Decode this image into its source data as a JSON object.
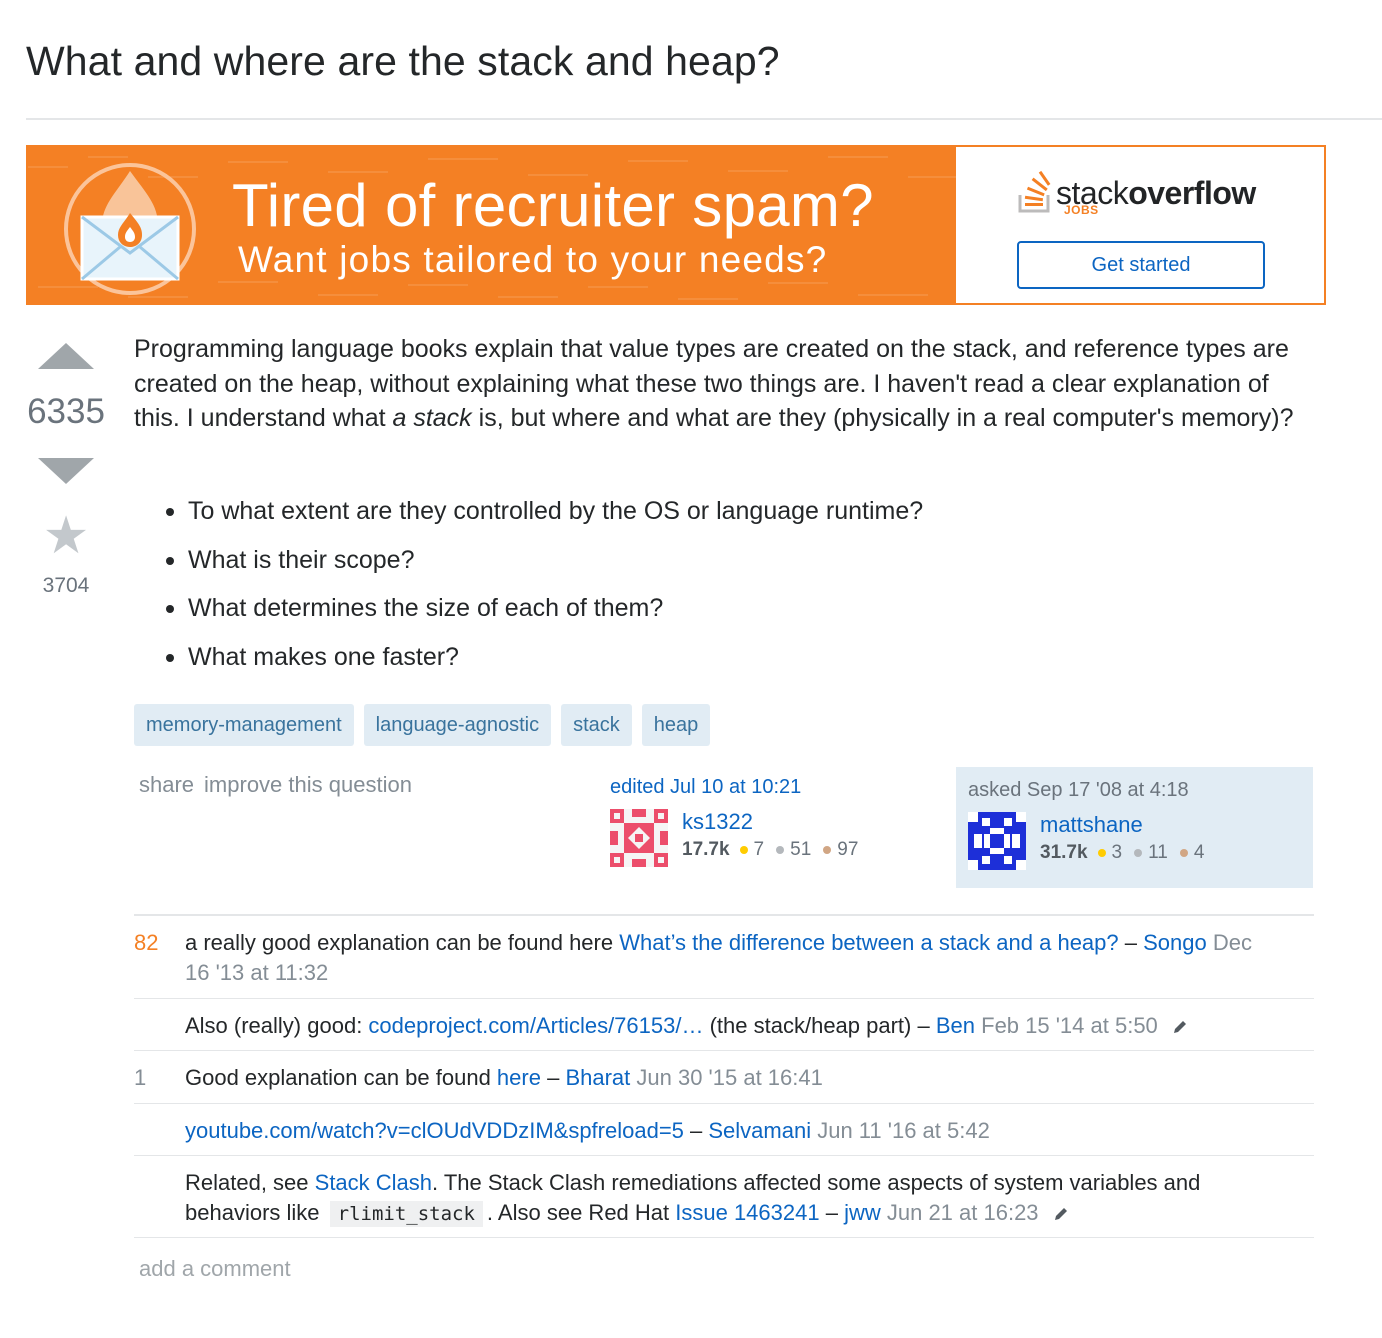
{
  "question": {
    "title": "What and where are the stack and heap?",
    "votes": "6335",
    "favorites": "3704",
    "body_part1": "Programming language books explain that value types are created on the stack, and reference types are created on the heap, without explaining what these two things are. I haven't read a clear explanation of this. I understand what ",
    "body_em": "a stack",
    "body_part2": " is, but where and what are they (physically in a real computer's memory)?",
    "bullets": [
      "To what extent are they controlled by the OS or language runtime?",
      "What is their scope?",
      "What determines the size of each of them?",
      "What makes one faster?"
    ],
    "tags": [
      "memory-management",
      "language-agnostic",
      "stack",
      "heap"
    ]
  },
  "banner": {
    "headline": "Tired of recruiter spam?",
    "subline": "Want jobs tailored to your needs?",
    "logo_light": "stack",
    "logo_bold": "overflow",
    "logo_jobs": "JOBS",
    "button": "Get started"
  },
  "menu": {
    "share": "share",
    "improve": "improve this question"
  },
  "edited": {
    "label": "edited Jul 10 at 10:21",
    "user": "ks1322",
    "rep": "17.7k",
    "gold": "7",
    "silver": "51",
    "bronze": "97"
  },
  "asked": {
    "label": "asked Sep 17 '08 at 4:18",
    "user": "mattshane",
    "rep": "31.7k",
    "gold": "3",
    "silver": "11",
    "bronze": "4"
  },
  "comments": [
    {
      "score": "82",
      "text": "a really good explanation can be found here ",
      "link": "What’s the difference between a stack and a heap?",
      "sep": " – ",
      "user": "Songo",
      "date": "Dec 16 '13 at 11:32"
    },
    {
      "score": "",
      "text": "Also (really) good: ",
      "link": "codeproject.com/Articles/76153/…",
      "after": " (the stack/heap part)",
      "sep": " – ",
      "user": "Ben",
      "date": "Feb 15 '14 at 5:50"
    },
    {
      "score": "1",
      "text": "Good explanation can be found ",
      "link": "here",
      "sep": " – ",
      "user": "Bharat",
      "date": "Jun 30 '15 at 16:41"
    },
    {
      "score": "",
      "link": "youtube.com/watch?v=clOUdVDDzIM&spfreload=5",
      "sep": " – ",
      "user": "Selvamani",
      "date": "Jun 11 '16 at 5:42"
    },
    {
      "score": "",
      "text": "Related, see ",
      "link": "Stack Clash",
      "mid": ". The Stack Clash remediations affected some aspects of system variables and behaviors like ",
      "code": "rlimit_stack",
      "mid2": ". Also see Red Hat ",
      "link2": "Issue 1463241",
      "sep": " – ",
      "user": "jww",
      "date": "Jun 21 at 16:23"
    }
  ],
  "add_comment": "add a comment",
  "colors": {
    "orange": "#f48024",
    "link": "#0c65c2",
    "tag_bg": "#e1ecf4",
    "tag_text": "#39739d"
  }
}
